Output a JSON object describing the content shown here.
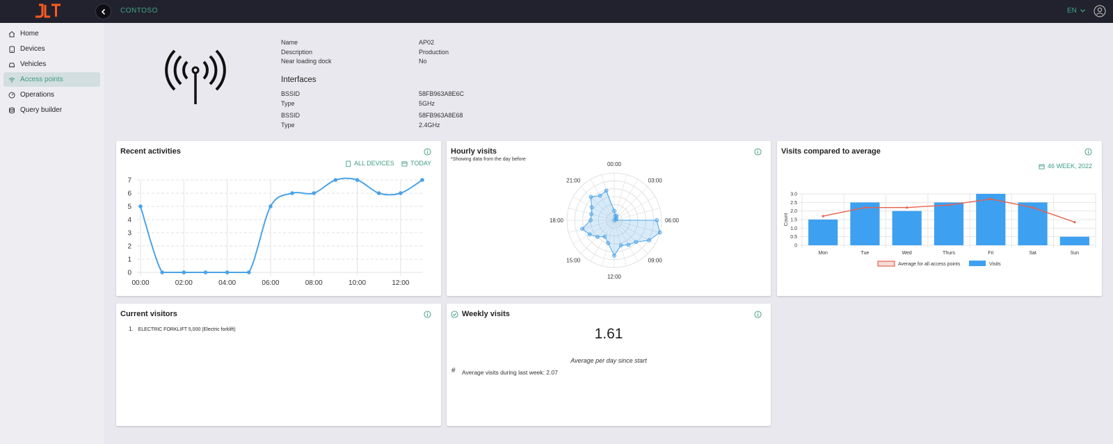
{
  "header": {
    "logo_text": "JLT",
    "app_title": "CONTOSO",
    "language": "EN"
  },
  "sidebar": {
    "items": [
      {
        "label": "Home",
        "icon": "home-icon"
      },
      {
        "label": "Devices",
        "icon": "tablet-icon"
      },
      {
        "label": "Vehicles",
        "icon": "car-icon"
      },
      {
        "label": "Access points",
        "icon": "wifi-icon",
        "active": true
      },
      {
        "label": "Operations",
        "icon": "gauge-icon"
      },
      {
        "label": "Query builder",
        "icon": "database-icon"
      }
    ]
  },
  "access_point": {
    "icon": "antenna-icon",
    "fields": [
      {
        "label": "Name",
        "value": "AP02"
      },
      {
        "label": "Description",
        "value": "Production"
      },
      {
        "label": "Near loading dock",
        "value": "No"
      }
    ],
    "interfaces_title": "Interfaces",
    "interfaces": [
      {
        "bssid_label": "BSSID",
        "bssid": "58FB963A8E6C",
        "type_label": "Type",
        "type": "5GHz"
      },
      {
        "bssid_label": "BSSID",
        "bssid": "58FB963A8E68",
        "type_label": "Type",
        "type": "2.4GHz"
      }
    ]
  },
  "recent_activities": {
    "title": "Recent activities",
    "filter_devices": "ALL DEVICES",
    "filter_date": "TODAY",
    "chart_data": {
      "type": "line",
      "x": [
        "00:00",
        "01:00",
        "02:00",
        "03:00",
        "04:00",
        "05:00",
        "06:00",
        "07:00",
        "08:00",
        "09:00",
        "10:00",
        "11:00",
        "12:00",
        "13:00"
      ],
      "values": [
        5,
        0,
        0,
        0,
        0,
        0,
        5,
        6,
        6,
        7,
        7,
        6,
        6,
        7
      ],
      "x_tick_labels": [
        "00:00",
        "02:00",
        "04:00",
        "06:00",
        "08:00",
        "10:00",
        "12:00"
      ],
      "y_ticks": [
        0,
        1,
        2,
        3,
        4,
        5,
        6,
        7
      ],
      "ylim": [
        0,
        7
      ],
      "grid": true,
      "color": "#4aa3e8"
    }
  },
  "hourly_visits": {
    "title": "Hourly visits",
    "note": "*Showing data from the day before",
    "chart_data": {
      "type": "radar",
      "hour_labels": [
        "00:00",
        "03:00",
        "06:00",
        "09:00",
        "12:00",
        "15:00",
        "18:00",
        "21:00"
      ],
      "values": [
        0.2,
        0.1,
        0.1,
        0.05,
        0.05,
        0.01,
        0.9,
        1.0,
        0.85,
        0.65,
        0.6,
        0.55,
        0.75,
        0.5,
        0.4,
        0.5,
        0.6,
        0.7,
        0.5,
        0.5,
        0.55,
        0.7,
        0.6,
        0.65
      ],
      "rmax": 1.0,
      "grid_rings": 6,
      "color": "#4aa3e8"
    }
  },
  "visits_compared": {
    "title": "Visits compared to average",
    "week": "46 WEEK, 2022",
    "chart_data": {
      "type": "bar",
      "categories": [
        "Mon",
        "Tue",
        "Wed",
        "Thurs",
        "Fri",
        "Sat",
        "Sun"
      ],
      "series": [
        {
          "name": "Visits",
          "type": "bar",
          "values": [
            1.5,
            2.5,
            2.0,
            2.5,
            3.0,
            2.5,
            0.5
          ],
          "color": "#3ea0f0"
        },
        {
          "name": "Average for all access points",
          "type": "line",
          "values": [
            1.7,
            2.2,
            2.2,
            2.35,
            2.7,
            2.2,
            1.35
          ],
          "color": "#e8604c"
        }
      ],
      "ylabel": "Count",
      "y_ticks": [
        "0",
        "0.5",
        "1.0",
        "1.5",
        "2.0",
        "2.5",
        "3.0"
      ],
      "ylim": [
        0,
        3
      ],
      "legend_position": "bottom",
      "grid": true
    }
  },
  "current_visitors": {
    "title": "Current visitors",
    "items": [
      "ELECTRIC FORKLIFT 5,000 (Electric forklift)"
    ]
  },
  "weekly_visits": {
    "title": "Weekly visits",
    "value": "1.61",
    "caption": "Average per day since start",
    "last_week": "Average visits during last week: 2.07"
  }
}
